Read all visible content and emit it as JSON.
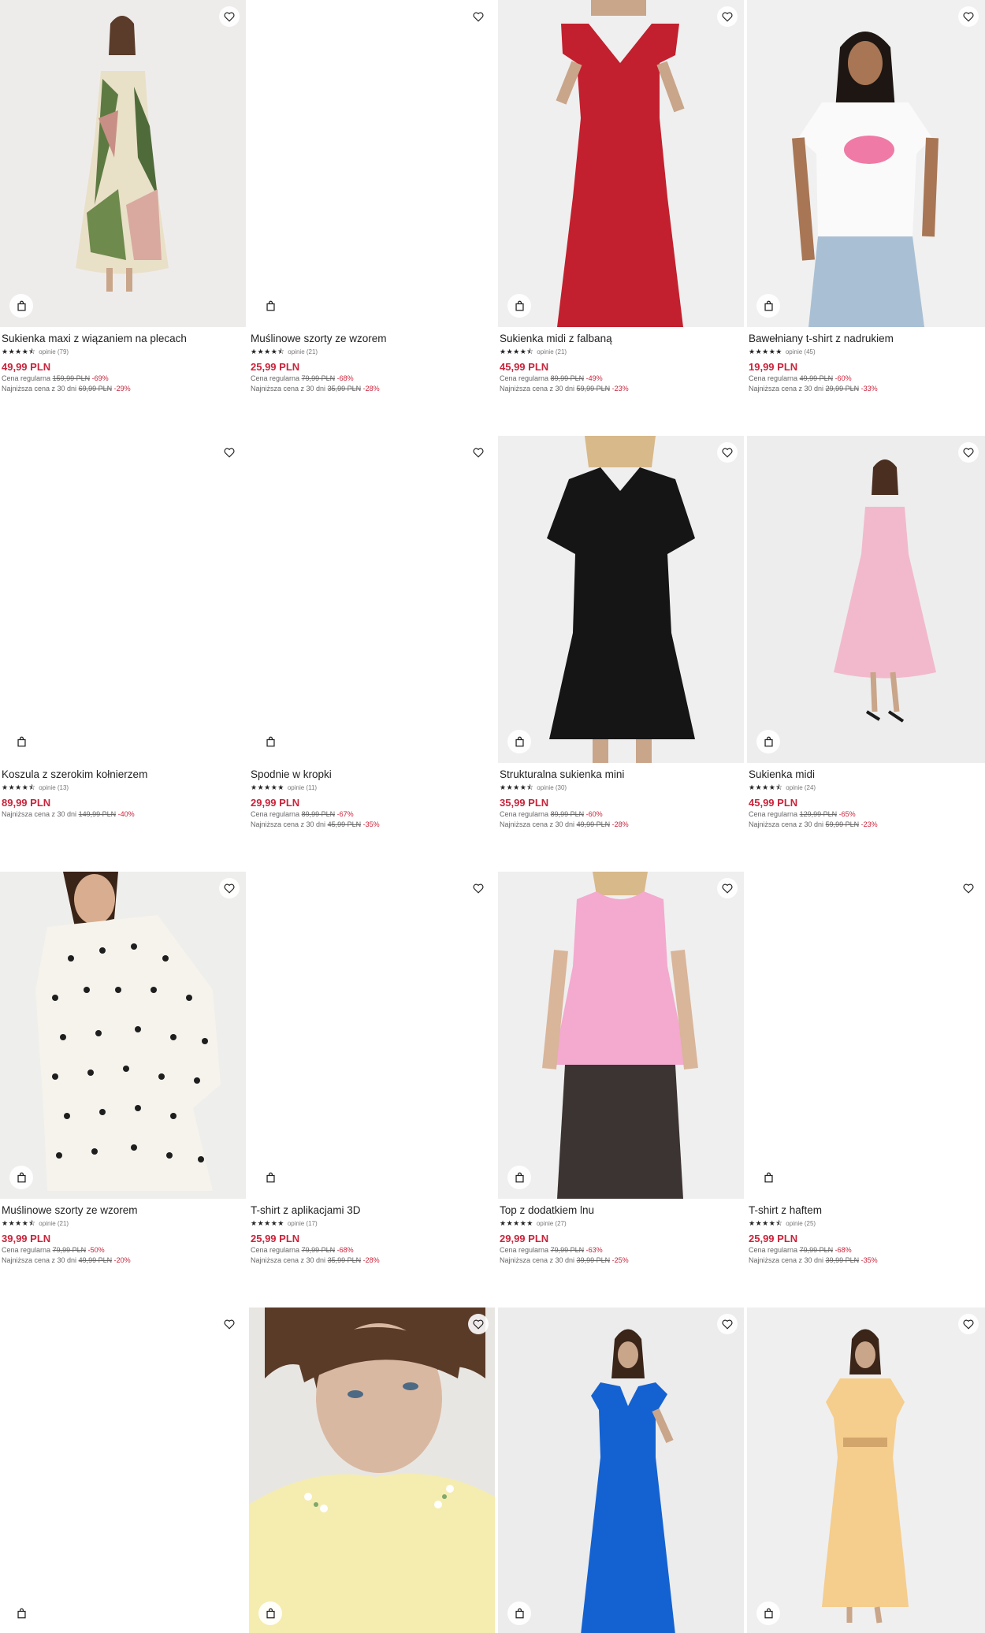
{
  "colors": {
    "accent": "#c8243b",
    "text": "#222222",
    "muted": "#666666"
  },
  "icons": {
    "favorite": "heart-outline-icon",
    "bag": "shopping-bag-icon"
  },
  "labels": {
    "regular": "Cena regularna",
    "lowest": "Najniższa cena z 30 dni"
  },
  "products": [
    {
      "name": "Sukienka maxi z wiązaniem na plecach",
      "stars": "★★★★⯪",
      "reviews": "opinie (79)",
      "price": "49,99 PLN",
      "regular_old": "159,99 PLN",
      "regular_pct": "-69%",
      "lowest_old": "69,99 PLN",
      "lowest_pct": "-29%"
    },
    {
      "name": "Muślinowe szorty ze wzorem",
      "stars": "★★★★⯪",
      "reviews": "opinie (21)",
      "price": "25,99 PLN",
      "regular_old": "79,99 PLN",
      "regular_pct": "-68%",
      "lowest_old": "35,99 PLN",
      "lowest_pct": "-28%"
    },
    {
      "name": "Sukienka midi z falbaną",
      "stars": "★★★★⯪",
      "reviews": "opinie (21)",
      "price": "45,99 PLN",
      "regular_old": "89,99 PLN",
      "regular_pct": "-49%",
      "lowest_old": "59,99 PLN",
      "lowest_pct": "-23%"
    },
    {
      "name": "Bawełniany t-shirt z nadrukiem",
      "stars": "★★★★★",
      "reviews": "opinie (45)",
      "price": "19,99 PLN",
      "regular_old": "49,99 PLN",
      "regular_pct": "-60%",
      "lowest_old": "29,99 PLN",
      "lowest_pct": "-33%"
    },
    {
      "name": "Koszula z szerokim kołnierzem",
      "stars": "★★★★⯪",
      "reviews": "opinie (13)",
      "price": "89,99 PLN",
      "lowest_old": "149,99 PLN",
      "lowest_pct": "-40%"
    },
    {
      "name": "Spodnie w kropki",
      "stars": "★★★★★",
      "reviews": "opinie (11)",
      "price": "29,99 PLN",
      "regular_old": "89,99 PLN",
      "regular_pct": "-67%",
      "lowest_old": "45,99 PLN",
      "lowest_pct": "-35%"
    },
    {
      "name": "Strukturalna sukienka mini",
      "stars": "★★★★⯪",
      "reviews": "opinie (30)",
      "price": "35,99 PLN",
      "regular_old": "89,99 PLN",
      "regular_pct": "-60%",
      "lowest_old": "49,99 PLN",
      "lowest_pct": "-28%"
    },
    {
      "name": "Sukienka midi",
      "stars": "★★★★⯪",
      "reviews": "opinie (24)",
      "price": "45,99 PLN",
      "regular_old": "129,99 PLN",
      "regular_pct": "-65%",
      "lowest_old": "59,99 PLN",
      "lowest_pct": "-23%"
    },
    {
      "name": "Muślinowe szorty ze wzorem",
      "stars": "★★★★⯪",
      "reviews": "opinie (21)",
      "price": "39,99 PLN",
      "regular_old": "79,99 PLN",
      "regular_pct": "-50%",
      "lowest_old": "49,99 PLN",
      "lowest_pct": "-20%"
    },
    {
      "name": "T-shirt z aplikacjami 3D",
      "stars": "★★★★★",
      "reviews": "opinie (17)",
      "price": "25,99 PLN",
      "regular_old": "79,99 PLN",
      "regular_pct": "-68%",
      "lowest_old": "35,99 PLN",
      "lowest_pct": "-28%"
    },
    {
      "name": "Top z dodatkiem lnu",
      "stars": "★★★★★",
      "reviews": "opinie (27)",
      "price": "29,99 PLN",
      "regular_old": "79,99 PLN",
      "regular_pct": "-63%",
      "lowest_old": "39,99 PLN",
      "lowest_pct": "-25%"
    },
    {
      "name": "T-shirt z haftem",
      "stars": "★★★★⯪",
      "reviews": "opinie (25)",
      "price": "25,99 PLN",
      "regular_old": "79,99 PLN",
      "regular_pct": "-68%",
      "lowest_old": "39,99 PLN",
      "lowest_pct": "-35%"
    },
    {},
    {},
    {},
    {}
  ]
}
